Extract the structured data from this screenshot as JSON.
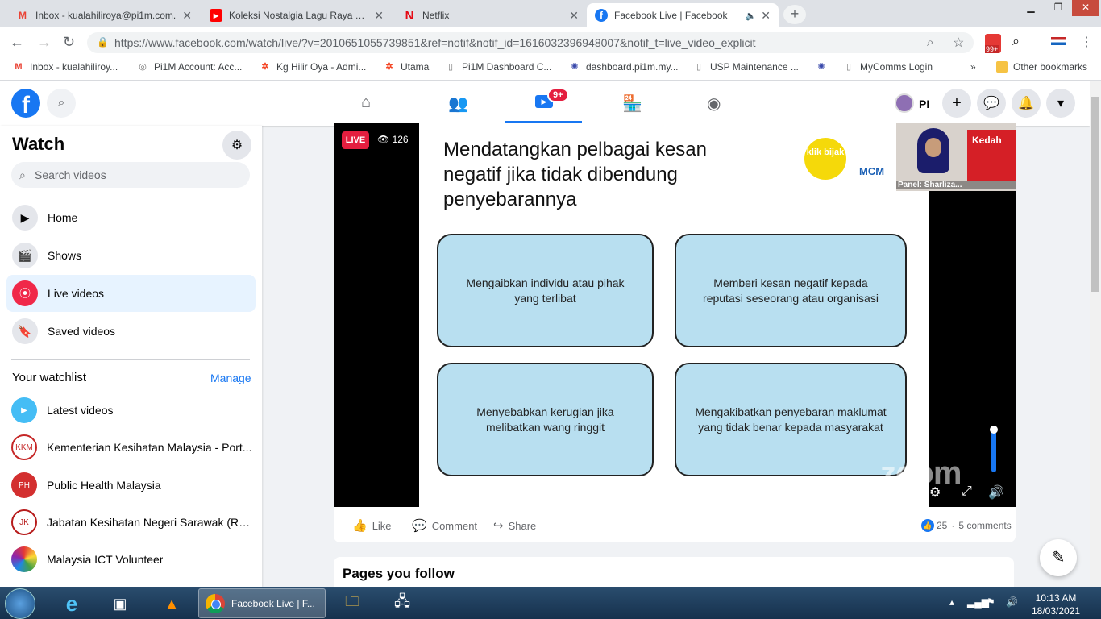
{
  "browser": {
    "tabs": [
      {
        "icon": "gmail-icon",
        "glyph": "M",
        "color": "#ea4335",
        "title": "Inbox - kualahiliroya@pi1m.com."
      },
      {
        "icon": "youtube-icon",
        "glyph": "▶",
        "color": "#ff0000",
        "title": "Koleksi Nostalgia Lagu Raya Terb"
      },
      {
        "icon": "netflix-icon",
        "glyph": "N",
        "color": "#e50914",
        "title": "Netflix"
      },
      {
        "icon": "facebook-icon",
        "glyph": "f",
        "color": "#1877f2",
        "title": "Facebook Live | Facebook"
      }
    ],
    "url": "https://www.facebook.com/watch/live/?v=2010651055739851&ref=notif&notif_id=1616032396948007&notif_t=live_video_explicit",
    "extension_badge": "99+",
    "bookmarks": [
      "Inbox - kualahiliroy...",
      "Pi1M Account: Acc...",
      "Kg Hilir Oya - Admi...",
      "Utama",
      "Pi1M Dashboard C...",
      "dashboard.pi1m.my...",
      "USP Maintenance ...",
      "MyComms Login"
    ],
    "other_bookmarks": "Other bookmarks",
    "more_bookmarks": "»"
  },
  "header": {
    "watch_badge": "9+",
    "profile_name": "PI"
  },
  "sidebar": {
    "title": "Watch",
    "search_placeholder": "Search videos",
    "items": [
      {
        "label": "Home"
      },
      {
        "label": "Shows"
      },
      {
        "label": "Live videos"
      },
      {
        "label": "Saved videos"
      }
    ],
    "watchlist_title": "Your watchlist",
    "manage_label": "Manage",
    "watchlist": [
      {
        "name": "Latest videos",
        "color": "#45bdf5"
      },
      {
        "name": "Kementerian Kesihatan Malaysia - Port...",
        "color": "#c62828"
      },
      {
        "name": "Public Health Malaysia",
        "color": "#d32f2f"
      },
      {
        "name": "Jabatan Kesihatan Negeri Sarawak (Ras...",
        "color": "#b71c1c"
      },
      {
        "name": "Malaysia ICT Volunteer",
        "color": "#7b1fa2"
      }
    ]
  },
  "video": {
    "live_label": "LIVE",
    "viewers": "126",
    "slide_title": "Mendatangkan pelbagai kesan negatif jika tidak dibendung penyebarannya",
    "klik_logo": "klik bijak",
    "mcm_logo": "MCM",
    "boxes": [
      "Mengaibkan individu atau pihak yang terlibat",
      "Memberi kesan negatif kepada reputasi seseorang atau organisasi",
      "Menyebabkan kerugian jika melibatkan wang ringgit",
      "Mengakibatkan penyebaran maklumat yang tidak benar kepada masyarakat"
    ],
    "panel_label": "Panel: Sharliza...",
    "panel_banner": "Kedah",
    "zoom_watermark": "zoom",
    "volume_level": 1.0
  },
  "actions": {
    "like": "Like",
    "comment": "Comment",
    "share": "Share",
    "reaction_count": "25",
    "comments_count": "5 comments"
  },
  "pages_section": {
    "title": "Pages you follow"
  },
  "taskbar": {
    "active_window": "Facebook Live | F...",
    "time": "10:13 AM",
    "date": "18/03/2021"
  }
}
